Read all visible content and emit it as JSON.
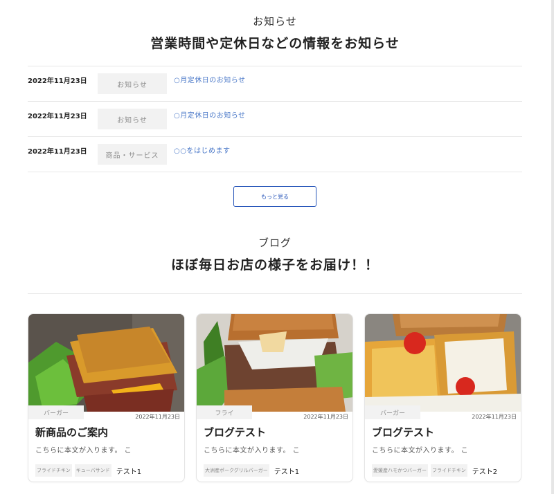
{
  "news": {
    "eyebrow": "お知らせ",
    "headline": "営業時間や定休日などの情報をお知らせ",
    "items": [
      {
        "date": "2022年11月23日",
        "category": "お知らせ",
        "title": "○月定休日のお知らせ"
      },
      {
        "date": "2022年11月23日",
        "category": "お知らせ",
        "title": "○月定休日のお知らせ"
      },
      {
        "date": "2022年11月23日",
        "category": "商品・サービス",
        "title": "○○をはじめます"
      }
    ],
    "more_label": "もっと見る"
  },
  "blog": {
    "eyebrow": "ブログ",
    "headline": "ほぼ毎日お店の様子をお届け！！",
    "cards": [
      {
        "category": "バーガー",
        "date": "2022年11月23日",
        "title": "新商品のご案内",
        "excerpt": "こちらに本文が入ります。 こ",
        "tags": [
          "フライドチキン",
          "キューバサンド"
        ],
        "author": "テスト1"
      },
      {
        "category": "フライ",
        "date": "2022年11月23日",
        "title": "ブログテスト",
        "excerpt": "こちらに本文が入ります。 こ",
        "tags": [
          "大洲産ポークグリルバーガー"
        ],
        "author": "テスト1"
      },
      {
        "category": "バーガー",
        "date": "2022年11月23日",
        "title": "ブログテスト",
        "excerpt": "こちらに本文が入ります。 こ",
        "tags": [
          "愛媛産ハモかつバーガー",
          "フライドチキン"
        ],
        "author": "テスト2"
      }
    ]
  }
}
